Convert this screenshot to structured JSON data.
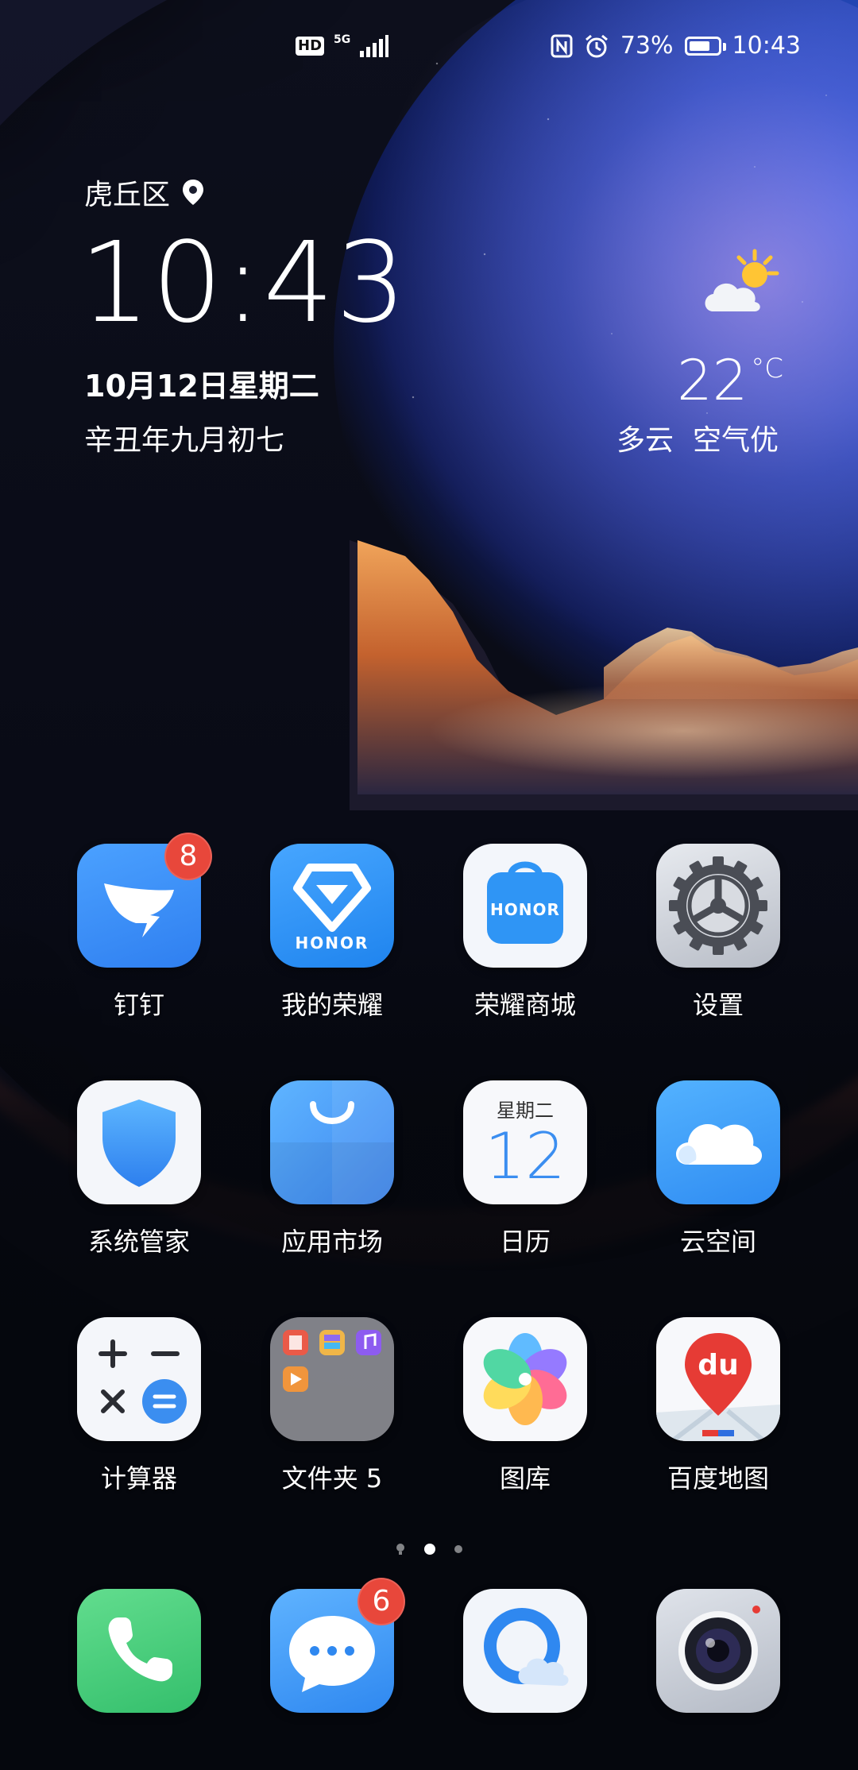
{
  "status_bar": {
    "hd_label": "HD",
    "network_label": "5G",
    "battery_percent_text": "73%",
    "battery_level": 0.73,
    "time": "10:43"
  },
  "clock_widget": {
    "location": "虎丘区",
    "time": "10:43",
    "date": "10月12日星期二",
    "lunar_date": "辛丑年九月初七"
  },
  "weather": {
    "temperature": "22",
    "unit": "°C",
    "condition": "多云",
    "air_quality": "空气优",
    "icon": "partly-cloudy-sun-icon"
  },
  "apps": [
    {
      "name": "钉钉",
      "icon": "dingtalk-icon",
      "badge": "8"
    },
    {
      "name": "我的荣耀",
      "icon": "my-honor-icon",
      "icon_text": "HONOR"
    },
    {
      "name": "荣耀商城",
      "icon": "honor-store-icon",
      "icon_text": "HONOR"
    },
    {
      "name": "设置",
      "icon": "settings-gear-icon"
    },
    {
      "name": "系统管家",
      "icon": "system-manager-shield-icon"
    },
    {
      "name": "应用市场",
      "icon": "app-market-bag-icon"
    },
    {
      "name": "日历",
      "icon": "calendar-icon",
      "icon_weekday": "星期二",
      "icon_day": "12"
    },
    {
      "name": "云空间",
      "icon": "cloud-space-icon"
    },
    {
      "name": "计算器",
      "icon": "calculator-icon"
    },
    {
      "name": "文件夹 5",
      "icon": "folder-icon"
    },
    {
      "name": "图库",
      "icon": "gallery-flower-icon"
    },
    {
      "name": "百度地图",
      "icon": "baidu-map-icon",
      "icon_text": "du"
    }
  ],
  "dock": [
    {
      "icon": "phone-icon"
    },
    {
      "icon": "messages-icon",
      "badge": "6"
    },
    {
      "icon": "browser-icon"
    },
    {
      "icon": "camera-icon"
    }
  ],
  "page_indicator": {
    "pages": 3,
    "active": 1
  },
  "colors": {
    "badge": "#e8473b",
    "dingtalk_blue": "#3a8df5",
    "honor_blue": "#2d8ff0",
    "phone_green": "#4bd17b"
  }
}
